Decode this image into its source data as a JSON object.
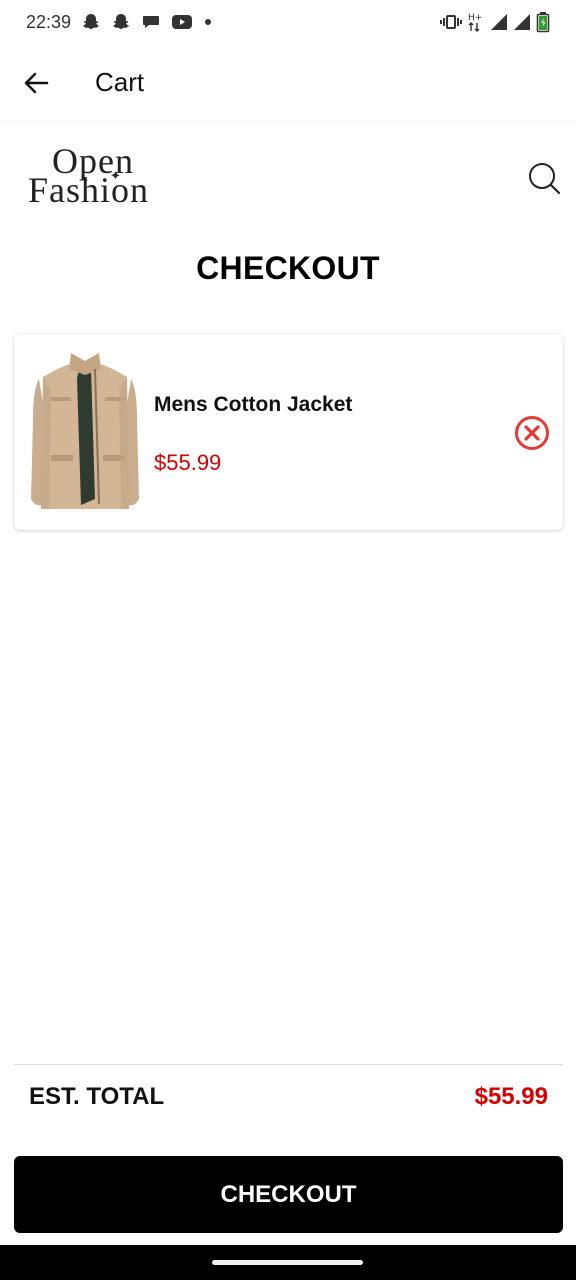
{
  "status_bar": {
    "time": "22:39",
    "network_label": "H+",
    "left_icons": [
      "snapchat-icon",
      "snapchat-icon",
      "chat-bubble-icon",
      "youtube-icon",
      "dot-icon"
    ],
    "right_icons": [
      "vibrate-icon",
      "network-type-icon",
      "signal-icon",
      "signal-icon",
      "battery-icon"
    ],
    "battery_color": "#2e9e2e"
  },
  "app_bar": {
    "title": "Cart",
    "back_icon": "arrow-left-icon"
  },
  "brand": {
    "logo_line1": "Open",
    "logo_line2": "Fashion",
    "search_icon": "search-icon"
  },
  "page": {
    "heading": "CHECKOUT"
  },
  "cart": {
    "items": [
      {
        "name": "Mens Cotton Jacket",
        "price": "$55.99",
        "image": "jacket-image"
      }
    ]
  },
  "summary": {
    "total_label": "EST. TOTAL",
    "total_value": "$55.99"
  },
  "actions": {
    "checkout_label": "CHECKOUT"
  },
  "colors": {
    "accent_red": "#d50000",
    "button_bg": "#000000",
    "button_text": "#ffffff"
  }
}
